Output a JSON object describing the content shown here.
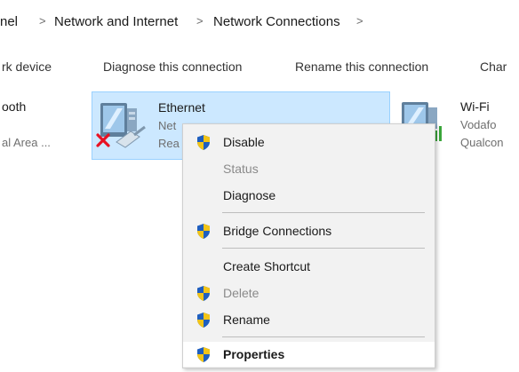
{
  "breadcrumb": {
    "items": [
      "nel",
      "Network and Internet",
      "Network Connections"
    ],
    "separator": ">"
  },
  "toolbar": {
    "items": [
      "rk device",
      "Diagnose this connection",
      "Rename this connection",
      "Char"
    ]
  },
  "adapters": {
    "bluetooth": {
      "name": "ooth",
      "sub": "al Area ..."
    },
    "ethernet": {
      "name": "Ethernet",
      "line1": "Net",
      "line2": "Rea"
    },
    "wifi": {
      "name": "Wi-Fi",
      "line1": "Vodafo",
      "line2": "Qualcon"
    }
  },
  "context_menu": {
    "disable": "Disable",
    "status": "Status",
    "diagnose": "Diagnose",
    "bridge": "Bridge Connections",
    "create_shortcut": "Create Shortcut",
    "delete": "Delete",
    "rename": "Rename",
    "properties": "Properties"
  },
  "colors": {
    "selection": "#cce8ff",
    "selection_border": "#99d1ff",
    "menu_bg": "#f2f2f2",
    "shield_blue": "#1f5fbf",
    "shield_yellow": "#f2c417",
    "error_x": "#e81123",
    "signal_green": "#3aa63a"
  }
}
